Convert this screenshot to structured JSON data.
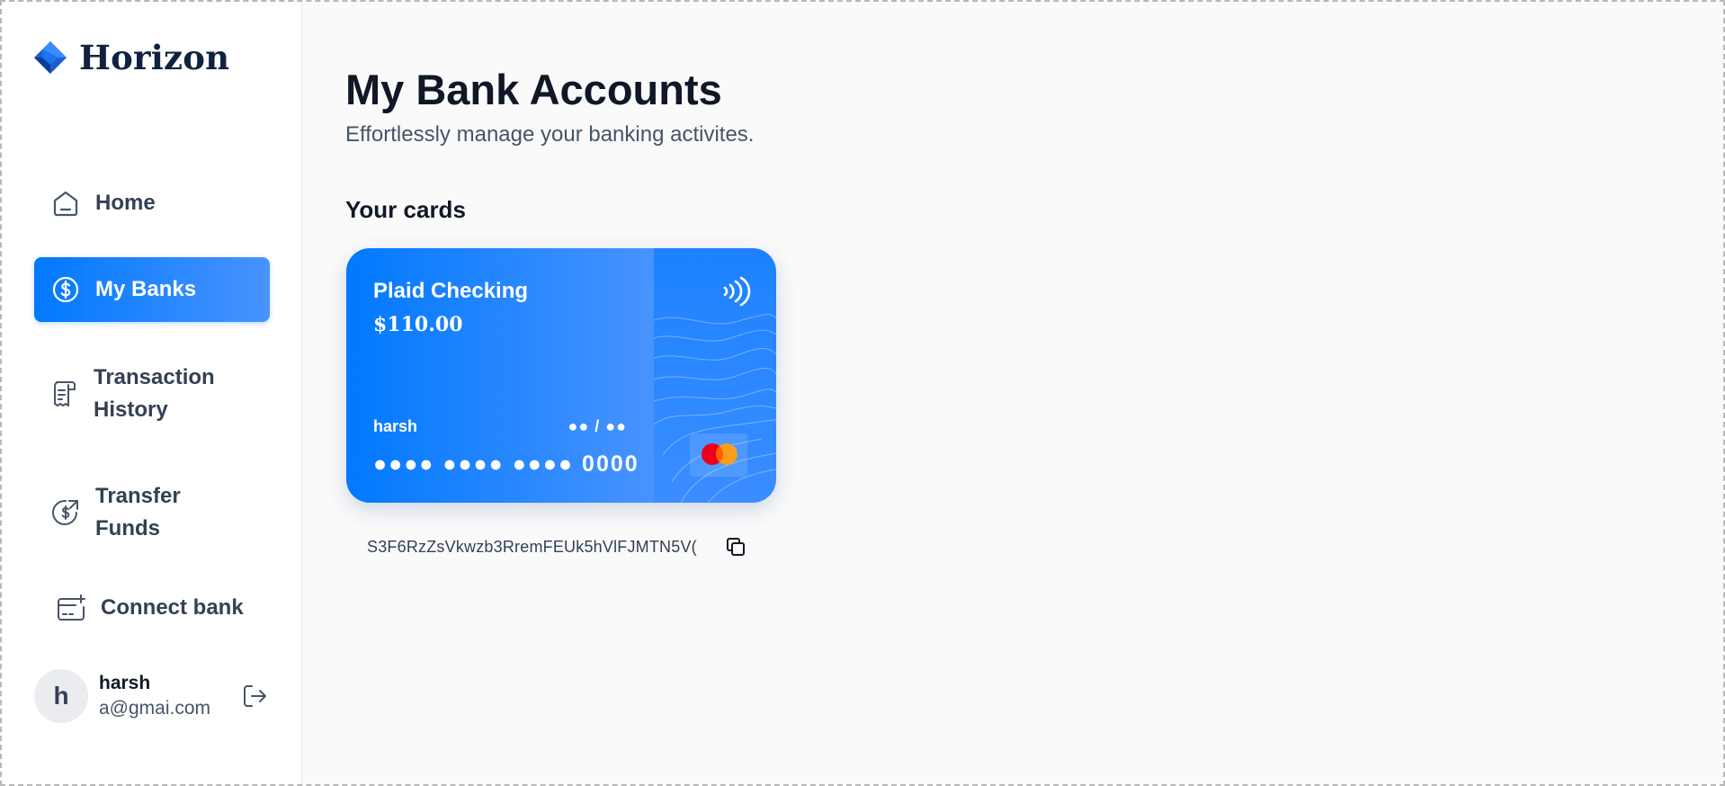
{
  "brand": {
    "name": "Horizon",
    "logo_icon": "horizon-logo-icon",
    "accent": "#0179fe"
  },
  "sidebar": {
    "items": [
      {
        "label": "Home",
        "icon": "home-icon",
        "active": false
      },
      {
        "label": "My Banks",
        "icon": "dollar-circle-icon",
        "active": true
      },
      {
        "label": "Transaction History",
        "icon": "receipt-icon",
        "active": false
      },
      {
        "label": "Transfer Funds",
        "icon": "money-send-icon",
        "active": false
      },
      {
        "label": "Connect bank",
        "icon": "card-add-icon",
        "active": false
      }
    ]
  },
  "user": {
    "initial": "h",
    "name": "harsh",
    "email": "a@gmai.com",
    "logout_icon": "logout-icon"
  },
  "main": {
    "title": "My Bank Accounts",
    "subtitle": "Effortlessly manage your banking activites.",
    "section_title": "Your cards",
    "cards": [
      {
        "name": "Plaid Checking",
        "balance": "$110.00",
        "holder": "harsh",
        "expiry": "●● / ●●",
        "number": "●●●● ●●●● ●●●● 0000",
        "share_id": "S3F6RzZsVkwzb3RremFEUk5hVlFJMTN5V(",
        "gradient_start": "#0179fe",
        "gradient_end": "#4893ff"
      }
    ]
  }
}
